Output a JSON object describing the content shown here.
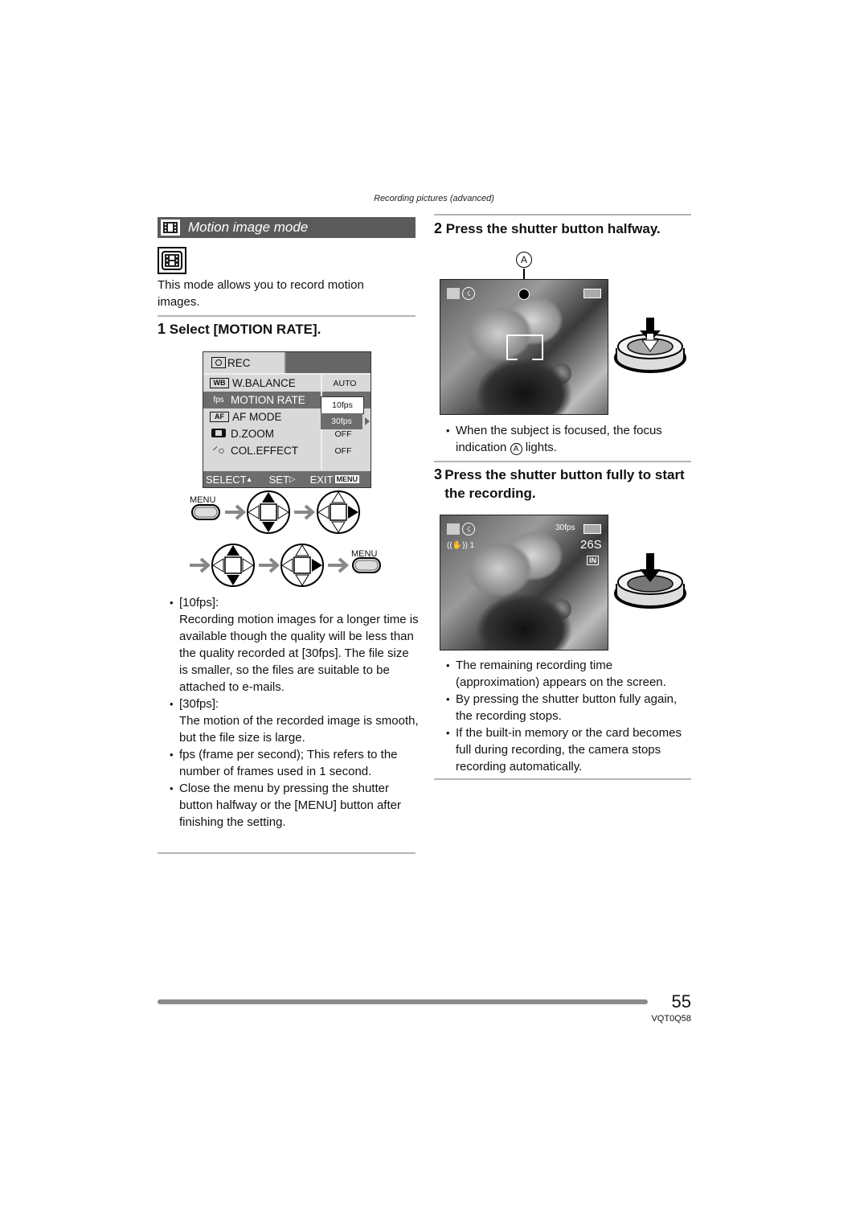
{
  "running_head": "Recording pictures (advanced)",
  "section": {
    "icon": "motion-picture-icon",
    "title": "Motion image mode"
  },
  "intro": "This mode allows you to record motion images.",
  "step1": {
    "number": "1",
    "title": "Select [MOTION RATE]."
  },
  "menu_screen": {
    "tab": "REC",
    "tab_icon": "camera-icon",
    "rows": [
      {
        "icon": "WB",
        "label": "W.BALANCE",
        "value": "AUTO"
      },
      {
        "icon": "fps",
        "label": "MOTION RATE",
        "value": ""
      },
      {
        "icon": "AF",
        "label": "AF MODE",
        "value": ""
      },
      {
        "icon": "dzoom",
        "label": "D.ZOOM",
        "value": "OFF"
      },
      {
        "icon": "coleffect",
        "label": "COL.EFFECT",
        "value": "OFF"
      }
    ],
    "options": [
      "10fps",
      "30fps"
    ],
    "selected_option": "30fps",
    "footer": {
      "select": "SELECT",
      "set": "SET",
      "exit": "EXIT",
      "menu_badge": "MENU"
    }
  },
  "button_sequence": {
    "menu_label": "MENU"
  },
  "notes_left": {
    "b1_head": "[10fps]:",
    "b1_body": "Recording motion images for a longer time is available though the quality will be less than the quality recorded at [30fps]. The file size is smaller, so the files are suitable to be attached to e-mails.",
    "b2_head": "[30fps]:",
    "b2_body": "The motion of the recorded image is smooth, but the file size is large.",
    "b3": "fps (frame per second);  This refers to the number of frames used in 1 second.",
    "b4": "Close the menu by pressing the shutter button halfway or the [MENU] button after finishing the setting."
  },
  "step2": {
    "number": "2",
    "title": "Press the shutter button halfway.",
    "callout": "A",
    "note_pre": "When the subject is focused, the focus indication ",
    "note_callout": "A",
    "note_post": " lights."
  },
  "step3": {
    "number": "3",
    "title": "Press the shutter button fully to start the recording.",
    "screen": {
      "fps": "30fps",
      "remaining": "26S",
      "stabilizer_mode": "1",
      "storage": "IN"
    },
    "notes": [
      "The remaining recording time (approximation) appears on the screen.",
      "By pressing the shutter button fully again, the recording stops.",
      "If the built-in memory or the card becomes full during recording, the camera stops recording automatically."
    ]
  },
  "footer": {
    "page_number": "55",
    "doc_code": "VQT0Q58"
  }
}
